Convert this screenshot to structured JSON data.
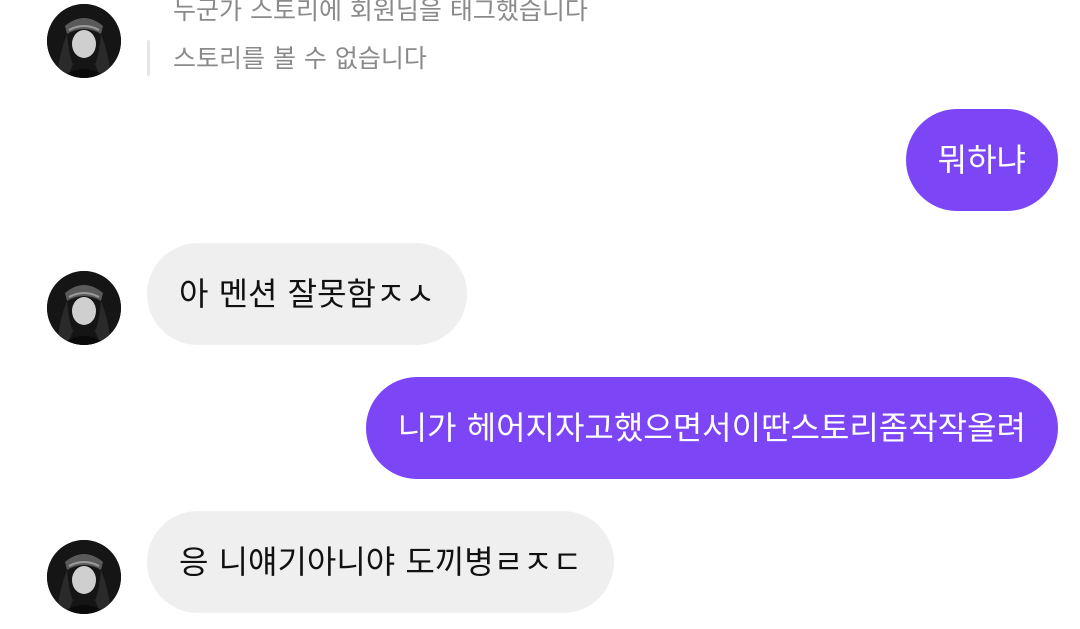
{
  "colors": {
    "outgoing_bubble": "#7c45f5",
    "incoming_bubble": "#efefef",
    "story_text": "#8a8a8a"
  },
  "story_reply": {
    "line1": "누군가 스토리에 회원님을 태그했습니다",
    "line2": "스토리를 볼 수 없습니다"
  },
  "messages": [
    {
      "direction": "outgoing",
      "text": "뭐하냐"
    },
    {
      "direction": "incoming",
      "text": "아 멘션 잘못함ㅈㅅ"
    },
    {
      "direction": "outgoing",
      "text": "니가 헤어지자고했으면서이딴스토리좀작작올려"
    },
    {
      "direction": "incoming",
      "text": "응 니얘기아니야 도끼병ㄹㅈㄷ"
    }
  ],
  "avatar_icon": "profile-photo"
}
